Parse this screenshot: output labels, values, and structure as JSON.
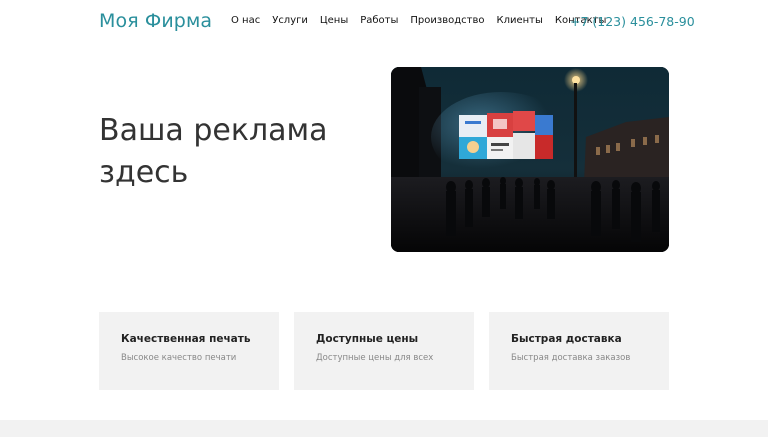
{
  "header": {
    "brand": "Моя Фирма",
    "nav": [
      "О нас",
      "Услуги",
      "Цены",
      "Работы",
      "Производство",
      "Клиенты",
      "Контакты"
    ],
    "phone": "+7 (123) 456-78-90"
  },
  "hero": {
    "title": "Ваша реклама здесь",
    "image_alt": "Night city square with illuminated advertising billboards"
  },
  "features": [
    {
      "title": "Качественная печать",
      "description": "Высокое качество печати"
    },
    {
      "title": "Доступные цены",
      "description": "Доступные цены для всех"
    },
    {
      "title": "Быстрая доставка",
      "description": "Быстрая доставка заказов"
    }
  ],
  "colors": {
    "accent": "#2a8f9c",
    "card_bg": "#f2f2f2",
    "text": "#333333"
  }
}
